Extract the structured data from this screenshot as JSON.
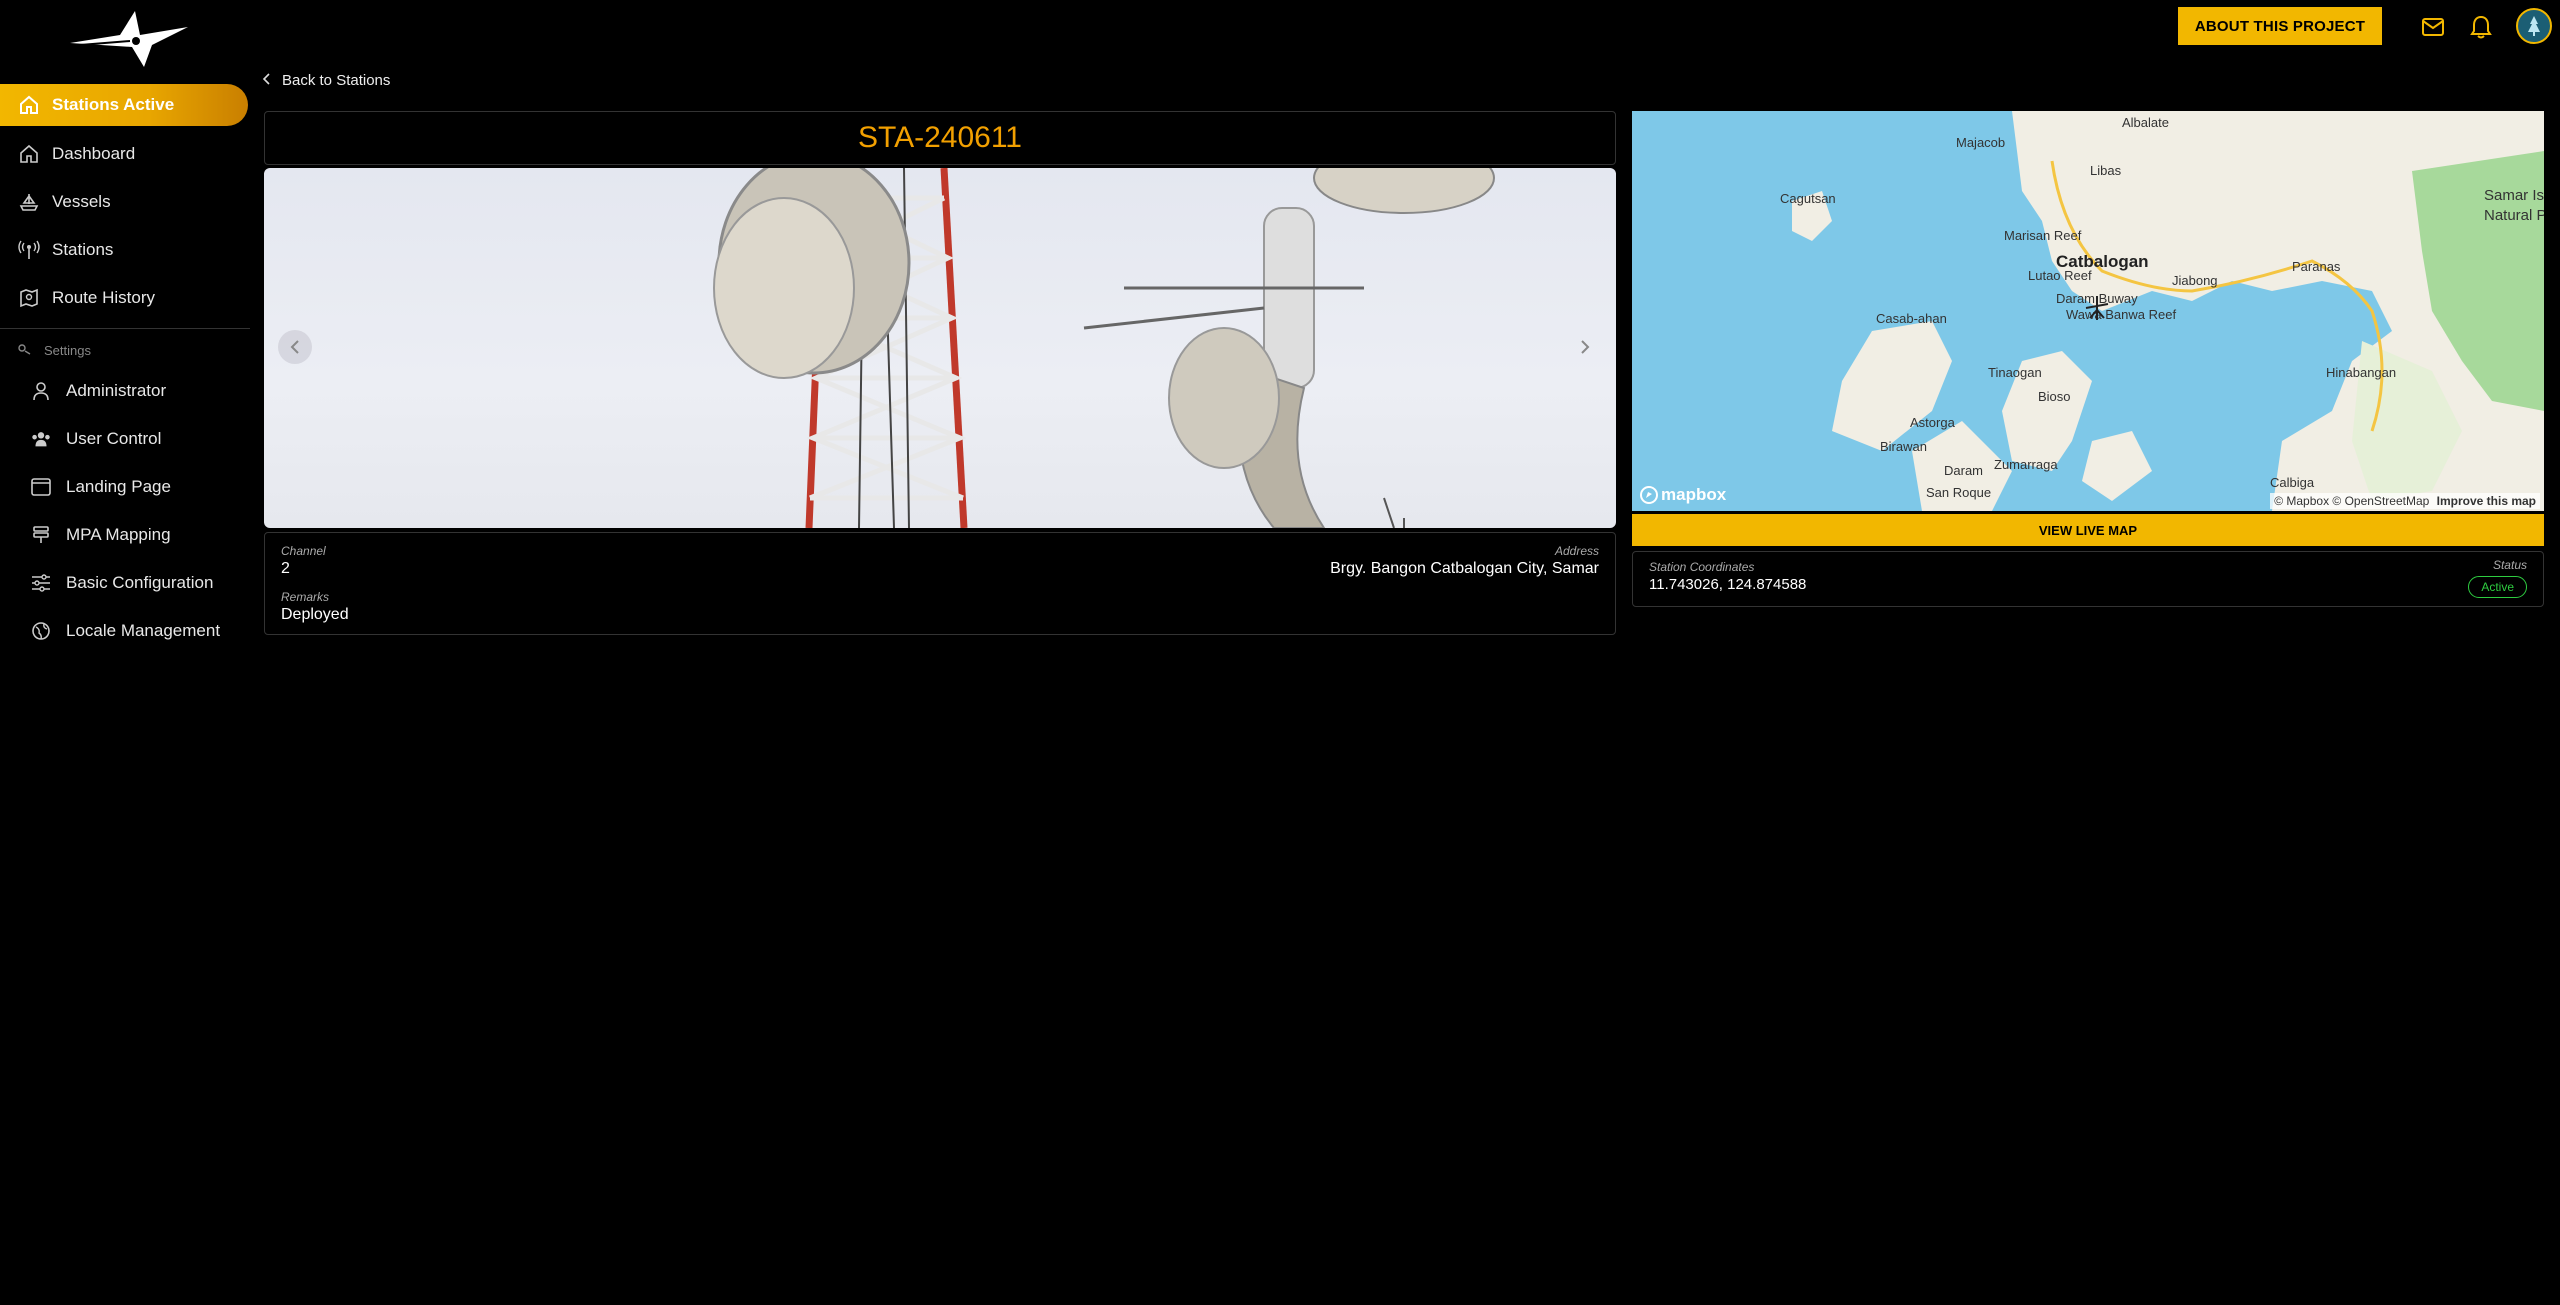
{
  "header": {
    "about_label": "ABOUT THIS PROJECT",
    "icons": [
      "mail-icon",
      "bell-icon",
      "user-avatar"
    ]
  },
  "sidebar": {
    "items": [
      {
        "label": "Stations Active",
        "icon": "home-icon",
        "active": true
      },
      {
        "label": "Dashboard",
        "icon": "home-icon"
      },
      {
        "label": "Vessels",
        "icon": "ship-icon"
      },
      {
        "label": "Stations",
        "icon": "antenna-icon"
      },
      {
        "label": "Route History",
        "icon": "map-icon"
      }
    ],
    "settings_label": "Settings",
    "settings_items": [
      {
        "label": "Administrator",
        "icon": "user-icon"
      },
      {
        "label": "User Control",
        "icon": "users-icon"
      },
      {
        "label": "Landing Page",
        "icon": "window-icon"
      },
      {
        "label": "MPA Mapping",
        "icon": "layers-icon"
      },
      {
        "label": "Basic Configuration",
        "icon": "sliders-icon"
      },
      {
        "label": "Locale Management",
        "icon": "globe-icon"
      }
    ]
  },
  "main": {
    "back_label": "Back to Stations",
    "station_id": "STA-240611",
    "details": {
      "channel_label": "Channel",
      "channel_value": "2",
      "address_label": "Address",
      "address_value": "Brgy. Bangon Catbalogan City, Samar",
      "remarks_label": "Remarks",
      "remarks_value": "Deployed"
    },
    "map": {
      "labels": {
        "albalate": "Albalate",
        "majacob": "Majacob",
        "libas": "Libas",
        "cagutsan": "Cagutsan",
        "marisan": "Marisan Reef",
        "catbalogan": "Catbalogan",
        "lutao": "Lutao Reef",
        "jiabong": "Jiabong",
        "paranas": "Paranas",
        "samar": "Samar Isla",
        "natural": "Natural P",
        "daram_buway": "Daram Buway",
        "banwa": "Wawa Banwa Reef",
        "casab": "Casab-ahan",
        "tinaogan": "Tinaogan",
        "bioso": "Bioso",
        "hinabangan": "Hinabangan",
        "astorga": "Astorga",
        "birawan": "Birawan",
        "zumarraga": "Zumarraga",
        "daram": "Daram",
        "sanroque": "San Roque",
        "calbiga": "Calbiga"
      },
      "attribution": "© Mapbox © OpenStreetMap",
      "improve": "Improve this map",
      "logo": "mapbox"
    },
    "live_map_label": "VIEW LIVE MAP",
    "coords_label": "Station Coordinates",
    "coords_value": "11.743026, 124.874588",
    "status_label": "Status",
    "status_value": "Active"
  }
}
